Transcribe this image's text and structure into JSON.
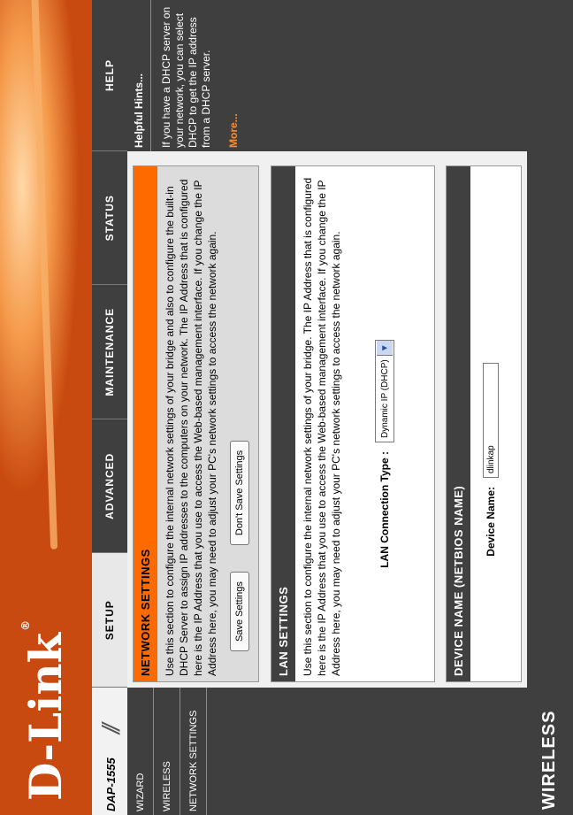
{
  "brand": {
    "logo": "D-Link",
    "model": "DAP-1555"
  },
  "tabs": [
    "SETUP",
    "ADVANCED",
    "MAINTENANCE",
    "STATUS",
    "HELP"
  ],
  "sidebar": {
    "items": [
      "WIZARD",
      "WIRELESS",
      "NETWORK SETTINGS"
    ]
  },
  "network_settings": {
    "title": "NETWORK SETTINGS",
    "description": "Use this section to configure the internal network settings of your bridge and also to configure the built-in DHCP Server to assign IP addresses to the computers on your network. The IP Address that is configured here is the IP Address that you use to access the Web-based management interface. If you change the IP Address here, you may need to adjust your PC's network settings to access the network again.",
    "save_label": "Save Settings",
    "dont_save_label": "Don't Save Settings"
  },
  "lan_settings": {
    "title": "LAN SETTINGS",
    "description": "Use this section to configure the internal network settings of your bridge. The IP Address that is configured here is the IP Address that you use to access the Web-based management interface. If you change the IP Address here, you may need to adjust your PC's network settings to access the network again.",
    "connection_type_label": "LAN Connection Type :",
    "connection_type_value": "Dynamic IP (DHCP)"
  },
  "device_name": {
    "title": "DEVICE NAME (NETBIOS NAME)",
    "label": "Device Name:",
    "value": "dlinkap"
  },
  "help": {
    "title": "Helpful Hints...",
    "text": "If you have a DHCP server on your network, you can select DHCP to get the IP address from a DHCP server.",
    "more": "More..."
  },
  "footer": {
    "label": "WIRELESS"
  },
  "colors": {
    "accent": "#ff6a00",
    "dark_panel": "#3f3f3f",
    "banner": "#c94a10"
  }
}
